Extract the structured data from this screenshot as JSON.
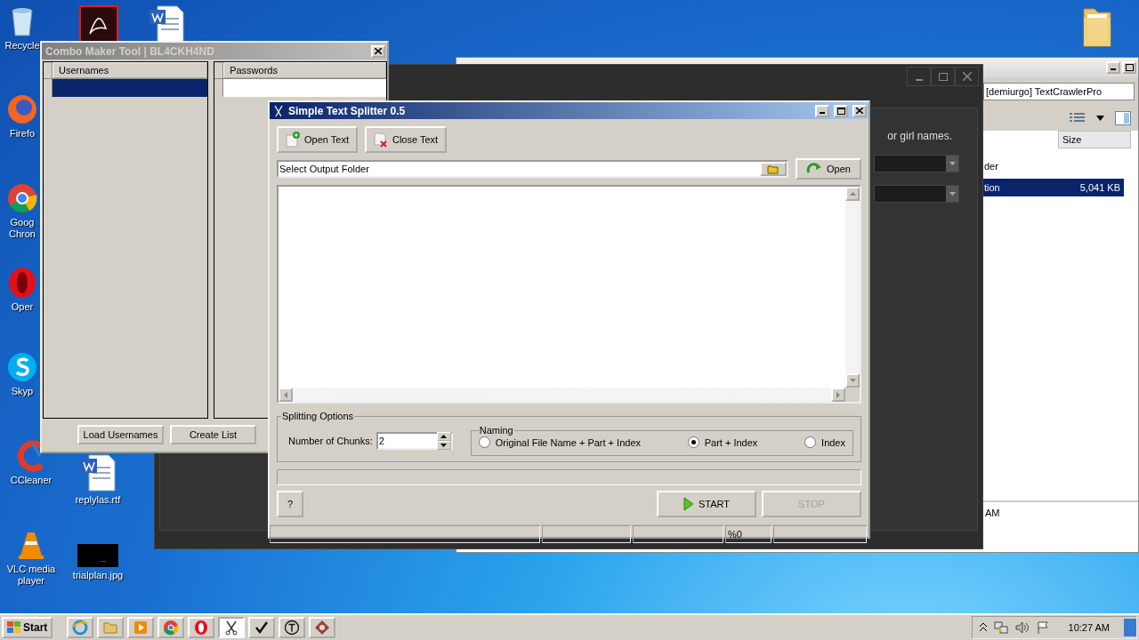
{
  "desktop_icons": [
    {
      "kind": "recycle",
      "lines": [
        "Recycle"
      ]
    },
    {
      "kind": "pdf"
    },
    {
      "kind": "word"
    },
    {
      "kind": "firefox",
      "lines": [
        "Firefo"
      ]
    },
    {
      "kind": "chrome",
      "lines": [
        "Goog",
        "Chron"
      ]
    },
    {
      "kind": "opera",
      "lines": [
        "Oper"
      ]
    },
    {
      "kind": "skype",
      "lines": [
        "Skyp"
      ]
    },
    {
      "kind": "ccleaner",
      "lines": [
        "CCleaner"
      ]
    },
    {
      "kind": "word",
      "lines": [
        "replylas.rtf"
      ]
    },
    {
      "kind": "vlc",
      "lines": [
        "VLC media",
        "player"
      ]
    },
    {
      "kind": "image",
      "lines": [
        "trialplan.jpg"
      ]
    },
    {
      "kind": "folder"
    }
  ],
  "explorer": {
    "address": "[demiurgo] TextCrawlerPro",
    "columns": [
      "Size"
    ],
    "rows": [
      {
        "name": "der",
        "selected": false
      },
      {
        "name": "tion",
        "size": "5,041 KB",
        "selected": true
      }
    ],
    "details": "AM"
  },
  "dark_window": {
    "text": "or girl names."
  },
  "combo_window": {
    "title": "Combo Maker Tool | BL4CKH4ND",
    "active": false,
    "lists": [
      {
        "header": "Usernames",
        "row_selected": true
      },
      {
        "header": "Passwords",
        "row_selected": false
      }
    ],
    "buttons": [
      "Load Usernames",
      "Create List"
    ]
  },
  "splitter_window": {
    "title": "Simple Text Splitter 0.5",
    "active": true,
    "toolbar": [
      {
        "kind": "open",
        "label": "Open Text"
      },
      {
        "kind": "close",
        "label": "Close Text"
      }
    ],
    "output_folder": "Select Output Folder",
    "open_button": "Open",
    "options": {
      "title": "Splitting Options",
      "chunks_label": "Number of Chunks:",
      "chunks": "2",
      "naming_title": "Naming",
      "radios": [
        {
          "label": "Original File Name + Part + Index",
          "selected": false
        },
        {
          "label": "Part + Index",
          "selected": true
        },
        {
          "label": "Index",
          "selected": false
        }
      ]
    },
    "progress_bar": {
      "level": 0
    },
    "help_button": "?",
    "start_button": "START",
    "stop_button": {
      "label": "STOP",
      "disabled": true
    },
    "progress": "%0"
  },
  "taskbar": {
    "start": "Start",
    "items": [
      {
        "kind": "ie",
        "selected": false
      },
      {
        "kind": "explorer",
        "selected": false
      },
      {
        "kind": "media",
        "selected": false
      },
      {
        "kind": "chrome",
        "selected": false
      },
      {
        "kind": "opera",
        "selected": false
      },
      {
        "kind": "splitter",
        "selected": true
      },
      {
        "kind": "check",
        "selected": false
      },
      {
        "kind": "t",
        "selected": false
      },
      {
        "kind": "app",
        "selected": false
      }
    ],
    "clock": "10:27 AM"
  }
}
